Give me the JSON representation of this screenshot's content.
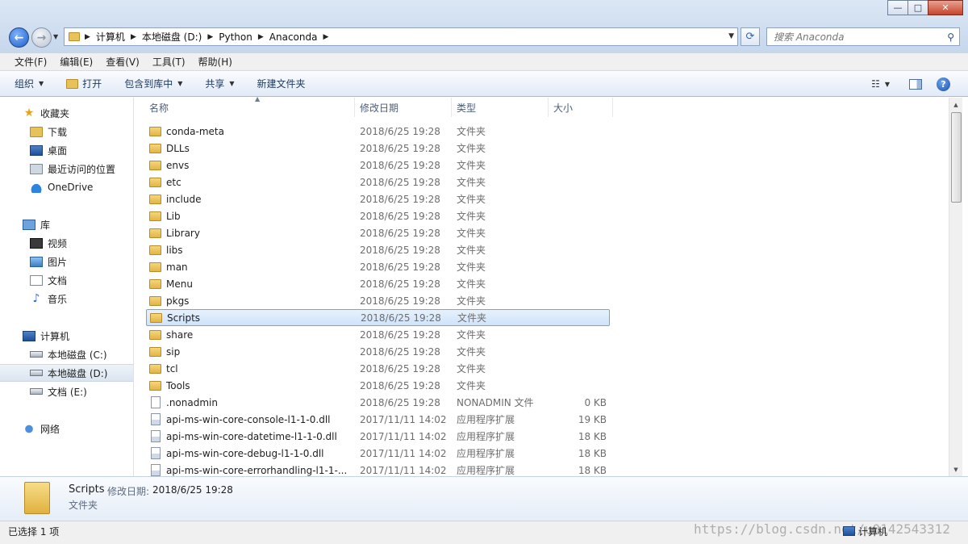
{
  "window": {
    "buttons": {
      "minimize": "—",
      "maximize": "□",
      "close": "✕"
    }
  },
  "address": {
    "crumbs": [
      "计算机",
      "本地磁盘 (D:)",
      "Python",
      "Anaconda"
    ]
  },
  "search": {
    "placeholder": "搜索 Anaconda"
  },
  "menu": [
    "文件(F)",
    "编辑(E)",
    "查看(V)",
    "工具(T)",
    "帮助(H)"
  ],
  "toolbar": {
    "organize": "组织",
    "open": "打开",
    "include_library": "包含到库中",
    "share": "共享",
    "new_folder": "新建文件夹"
  },
  "nav": {
    "favorites": "收藏夹",
    "downloads": "下载",
    "desktop": "桌面",
    "recent": "最近访问的位置",
    "onedrive": "OneDrive",
    "libraries": "库",
    "videos": "视频",
    "pictures": "图片",
    "documents": "文档",
    "music": "音乐",
    "computer": "计算机",
    "drive_c": "本地磁盘 (C:)",
    "drive_d": "本地磁盘 (D:)",
    "drive_e": "文档 (E:)",
    "network": "网络"
  },
  "columns": {
    "name": "名称",
    "date": "修改日期",
    "type": "类型",
    "size": "大小"
  },
  "files": [
    {
      "name": "conda-meta",
      "date": "2018/6/25 19:28",
      "type": "文件夹",
      "size": "",
      "kind": "folder"
    },
    {
      "name": "DLLs",
      "date": "2018/6/25 19:28",
      "type": "文件夹",
      "size": "",
      "kind": "folder"
    },
    {
      "name": "envs",
      "date": "2018/6/25 19:28",
      "type": "文件夹",
      "size": "",
      "kind": "folder"
    },
    {
      "name": "etc",
      "date": "2018/6/25 19:28",
      "type": "文件夹",
      "size": "",
      "kind": "folder"
    },
    {
      "name": "include",
      "date": "2018/6/25 19:28",
      "type": "文件夹",
      "size": "",
      "kind": "folder"
    },
    {
      "name": "Lib",
      "date": "2018/6/25 19:28",
      "type": "文件夹",
      "size": "",
      "kind": "folder"
    },
    {
      "name": "Library",
      "date": "2018/6/25 19:28",
      "type": "文件夹",
      "size": "",
      "kind": "folder"
    },
    {
      "name": "libs",
      "date": "2018/6/25 19:28",
      "type": "文件夹",
      "size": "",
      "kind": "folder"
    },
    {
      "name": "man",
      "date": "2018/6/25 19:28",
      "type": "文件夹",
      "size": "",
      "kind": "folder"
    },
    {
      "name": "Menu",
      "date": "2018/6/25 19:28",
      "type": "文件夹",
      "size": "",
      "kind": "folder"
    },
    {
      "name": "pkgs",
      "date": "2018/6/25 19:28",
      "type": "文件夹",
      "size": "",
      "kind": "folder"
    },
    {
      "name": "Scripts",
      "date": "2018/6/25 19:28",
      "type": "文件夹",
      "size": "",
      "kind": "folder",
      "selected": true
    },
    {
      "name": "share",
      "date": "2018/6/25 19:28",
      "type": "文件夹",
      "size": "",
      "kind": "folder"
    },
    {
      "name": "sip",
      "date": "2018/6/25 19:28",
      "type": "文件夹",
      "size": "",
      "kind": "folder"
    },
    {
      "name": "tcl",
      "date": "2018/6/25 19:28",
      "type": "文件夹",
      "size": "",
      "kind": "folder"
    },
    {
      "name": "Tools",
      "date": "2018/6/25 19:28",
      "type": "文件夹",
      "size": "",
      "kind": "folder"
    },
    {
      "name": ".nonadmin",
      "date": "2018/6/25 19:28",
      "type": "NONADMIN 文件",
      "size": "0 KB",
      "kind": "file"
    },
    {
      "name": "api-ms-win-core-console-l1-1-0.dll",
      "date": "2017/11/11 14:02",
      "type": "应用程序扩展",
      "size": "19 KB",
      "kind": "dll"
    },
    {
      "name": "api-ms-win-core-datetime-l1-1-0.dll",
      "date": "2017/11/11 14:02",
      "type": "应用程序扩展",
      "size": "18 KB",
      "kind": "dll"
    },
    {
      "name": "api-ms-win-core-debug-l1-1-0.dll",
      "date": "2017/11/11 14:02",
      "type": "应用程序扩展",
      "size": "18 KB",
      "kind": "dll"
    },
    {
      "name": "api-ms-win-core-errorhandling-l1-1-...",
      "date": "2017/11/11 14:02",
      "type": "应用程序扩展",
      "size": "18 KB",
      "kind": "dll"
    }
  ],
  "details": {
    "name": "Scripts",
    "date_label": "修改日期:",
    "date": "2018/6/25 19:28",
    "type": "文件夹"
  },
  "status": {
    "selection": "已选择 1 项",
    "location": "计算机",
    "watermark": "https://blog.csdn.net/u0142543312"
  }
}
